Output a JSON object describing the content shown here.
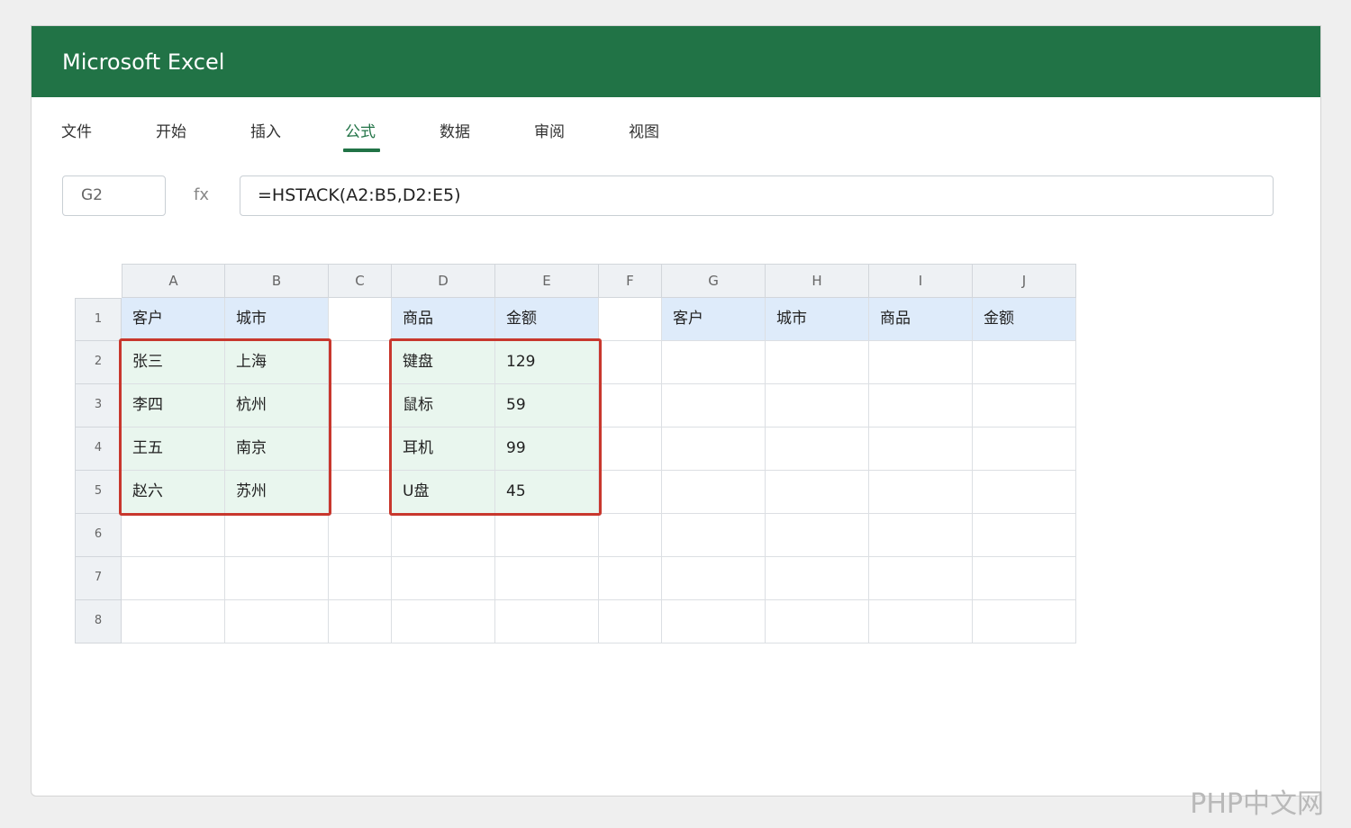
{
  "app": {
    "title": "Microsoft Excel"
  },
  "ribbon": {
    "tabs": [
      {
        "label": "文件"
      },
      {
        "label": "开始"
      },
      {
        "label": "插入"
      },
      {
        "label": "公式",
        "active": true
      },
      {
        "label": "数据"
      },
      {
        "label": "审阅"
      },
      {
        "label": "视图"
      }
    ]
  },
  "formula_bar": {
    "name_box": "G2",
    "fx_label": "fx",
    "formula": "=HSTACK(A2:B5,D2:E5)"
  },
  "sheet": {
    "columns": [
      "A",
      "B",
      "C",
      "D",
      "E",
      "F",
      "G",
      "H",
      "I",
      "J"
    ],
    "rows": [
      "1",
      "2",
      "3",
      "4",
      "5",
      "6",
      "7",
      "8"
    ],
    "cells": [
      [
        "客户",
        "城市",
        "",
        "商品",
        "金额",
        "",
        "客户",
        "城市",
        "商品",
        "金额"
      ],
      [
        "张三",
        "上海",
        "",
        "键盘",
        "129",
        "",
        "",
        "",
        "",
        ""
      ],
      [
        "李四",
        "杭州",
        "",
        "鼠标",
        "59",
        "",
        "",
        "",
        "",
        ""
      ],
      [
        "王五",
        "南京",
        "",
        "耳机",
        "99",
        "",
        "",
        "",
        "",
        ""
      ],
      [
        "赵六",
        "苏州",
        "",
        "U盘",
        "45",
        "",
        "",
        "",
        "",
        ""
      ],
      [
        "",
        "",
        "",
        "",
        "",
        "",
        "",
        "",
        "",
        ""
      ],
      [
        "",
        "",
        "",
        "",
        "",
        "",
        "",
        "",
        "",
        ""
      ],
      [
        "",
        "",
        "",
        "",
        "",
        "",
        "",
        "",
        "",
        ""
      ]
    ],
    "highlighted_ranges": [
      "A2:B5",
      "D2:E5"
    ]
  },
  "colors": {
    "brand": "#217346",
    "header_fill": "#deebfa",
    "range_fill": "#e9f6ee",
    "range_border": "#c8372d"
  },
  "watermark": "PHP中文网"
}
